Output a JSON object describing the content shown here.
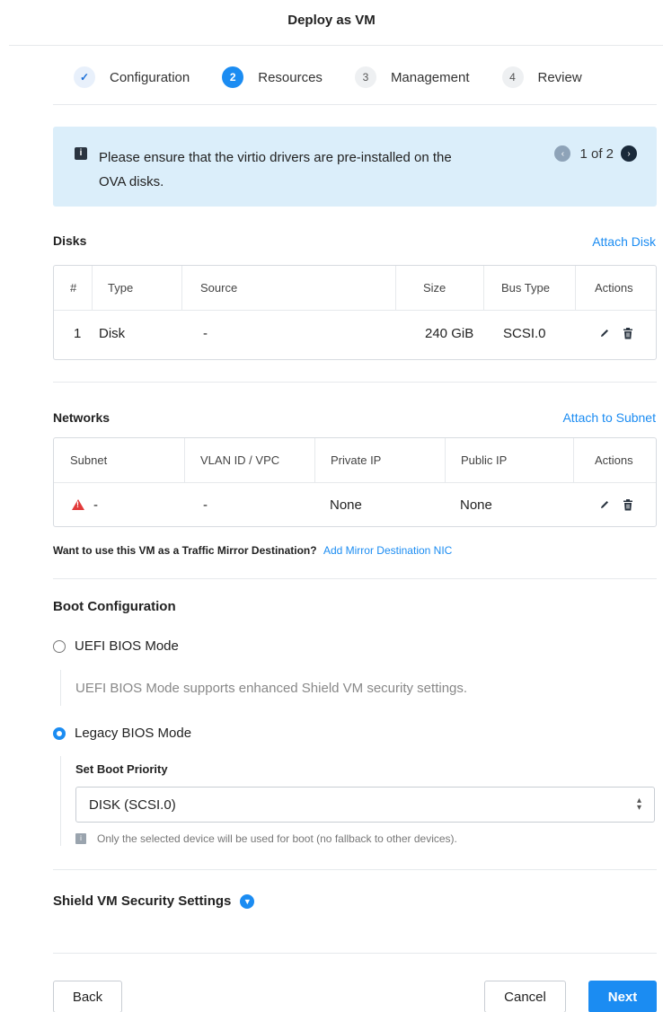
{
  "dialog": {
    "title": "Deploy as VM"
  },
  "steps": [
    {
      "number": "✓",
      "label": "Configuration",
      "state": "done"
    },
    {
      "number": "2",
      "label": "Resources",
      "state": "active"
    },
    {
      "number": "3",
      "label": "Management",
      "state": "todo"
    },
    {
      "number": "4",
      "label": "Review",
      "state": "todo"
    }
  ],
  "banner": {
    "icon": "i",
    "text": "Please ensure that the virtio drivers are pre-installed on the OVA disks.",
    "pager": "1 of 2",
    "prev_icon": "‹",
    "next_icon": "›"
  },
  "disks": {
    "title": "Disks",
    "action": "Attach Disk",
    "headers": {
      "num": "#",
      "type": "Type",
      "source": "Source",
      "size": "Size",
      "bus": "Bus Type",
      "actions": "Actions"
    },
    "rows": [
      {
        "num": "1",
        "type": "Disk",
        "source": "-",
        "size": "240 GiB",
        "bus": "SCSI.0"
      }
    ]
  },
  "networks": {
    "title": "Networks",
    "action": "Attach to Subnet",
    "headers": {
      "subnet": "Subnet",
      "vlan": "VLAN ID / VPC",
      "private_ip": "Private IP",
      "public_ip": "Public IP",
      "actions": "Actions"
    },
    "rows": [
      {
        "subnet": "-",
        "vlan": "-",
        "private_ip": "None",
        "public_ip": "None"
      }
    ]
  },
  "mirror": {
    "question": "Want to use this VM as a Traffic Mirror Destination?",
    "link": "Add Mirror Destination NIC"
  },
  "boot": {
    "title": "Boot Configuration",
    "uefi_label": "UEFI BIOS Mode",
    "uefi_note": "UEFI BIOS Mode supports enhanced Shield VM security settings.",
    "legacy_label": "Legacy BIOS Mode",
    "priority_label": "Set Boot Priority",
    "priority_value": "DISK (SCSI.0)",
    "priority_note": "Only the selected device will be used for boot (no fallback to other devices).",
    "selected_mode": "legacy"
  },
  "shield": {
    "title": "Shield VM Security Settings"
  },
  "footer": {
    "back": "Back",
    "cancel": "Cancel",
    "next": "Next"
  },
  "colors": {
    "accent": "#1b8cf2",
    "banner_bg": "#dbeefa",
    "warning": "#e23a3a"
  }
}
